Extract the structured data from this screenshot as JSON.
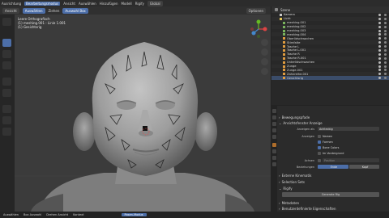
{
  "topbar": {
    "items": [
      "Ausrichtung",
      "Bearbeitungsmodus",
      "Ansicht",
      "Auswählen",
      "Hinzufügen",
      "Modell",
      "Rigify",
      "Global"
    ]
  },
  "header2": {
    "left": [
      "Ansicht",
      "Auswählen",
      "Ziehen",
      "Auswahl Box"
    ],
    "right": "Optionen"
  },
  "viewport": {
    "info_line1": "Leere Orthografisch",
    "info_line2": "(1) meshing.001 : Linie 1.001",
    "info_line3": "(1) Gesichtsrig"
  },
  "outliner": {
    "header": "Szene",
    "rows": [
      {
        "label": "Kamera",
        "color": "#c8c8c8",
        "sel": false
      },
      {
        "label": "Licht",
        "color": "#e1c452",
        "sel": false
      },
      {
        "label": "meshing.001",
        "color": "#79b35c",
        "sel": false
      },
      {
        "label": "meshing.002",
        "color": "#79b35c",
        "sel": false
      },
      {
        "label": "meshing.003",
        "color": "#79b35c",
        "sel": false
      },
      {
        "label": "meshing.004",
        "color": "#79b35c",
        "sel": false
      },
      {
        "label": "Oberlidschwachen",
        "color": "#e09c3f",
        "sel": false
      },
      {
        "label": "Stirnfalte",
        "color": "#e09c3f",
        "sel": false
      },
      {
        "label": "Tasche L",
        "color": "#e09c3f",
        "sel": false
      },
      {
        "label": "Tasche L.001",
        "color": "#e09c3f",
        "sel": false
      },
      {
        "label": "Tasche R",
        "color": "#e09c3f",
        "sel": false
      },
      {
        "label": "Tasche R.001",
        "color": "#e09c3f",
        "sel": false
      },
      {
        "label": "Unterlidschwachen",
        "color": "#e09c3f",
        "sel": false
      },
      {
        "label": "Zunge",
        "color": "#e09c3f",
        "sel": false
      },
      {
        "label": "Zunge.001",
        "color": "#e09c3f",
        "sel": false
      },
      {
        "label": "Zahnreihe.001",
        "color": "#e09c3f",
        "sel": false
      },
      {
        "label": "Gesichtsrig",
        "color": "#e09c3f",
        "sel": true
      }
    ]
  },
  "props": {
    "sections": [
      "Bewegungspfade",
      "Ansichtsfenster Anzeige",
      "Externe Kinematik",
      "Selection Sets",
      "Rigify",
      "Benutzerdefinierte Eigenschaften"
    ],
    "anzeigen_als_label": "Anzeigen als",
    "anzeigen_als_value": "Achteckig",
    "anzeigen_label": "Anzeigen",
    "checkboxes": [
      {
        "label": "Namen",
        "checked": false
      },
      {
        "label": "Formen",
        "checked": true
      },
      {
        "label": "Bone Colors",
        "checked": true
      },
      {
        "label": "Im Vordergrund",
        "checked": false
      }
    ],
    "achsen_label": "Achsen",
    "position_value": "Position",
    "beziehungen_label": "Beziehungen",
    "end_value": "Ende",
    "kopf_value": "Kopf",
    "generate_button": "Generate Rig",
    "meta_label": "Metadaten"
  },
  "statusbar": {
    "items": [
      "Auswählen",
      "Box Auswahl",
      "Drehen Ansicht",
      "Kontext"
    ],
    "mode_button": "Posen-Modus"
  }
}
